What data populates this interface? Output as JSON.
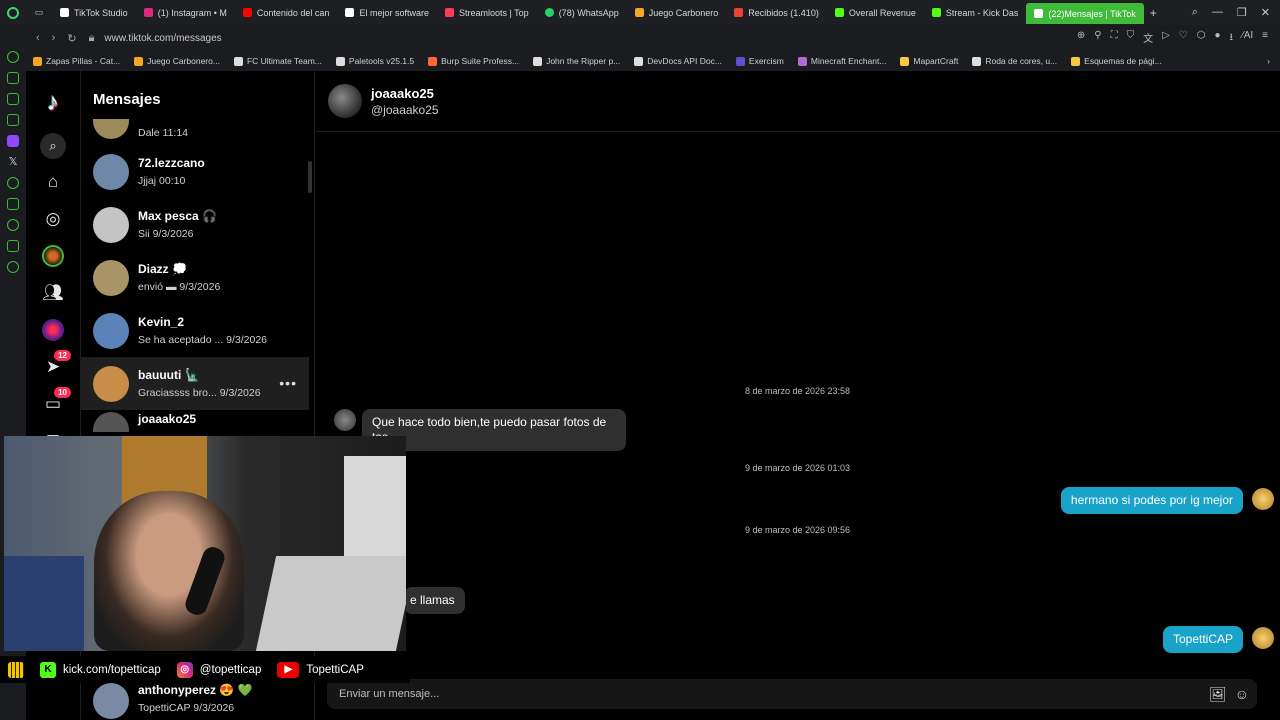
{
  "tabs": [
    {
      "label": "TikTok Studio",
      "color": "#ffffff"
    },
    {
      "label": "(1) Instagram • M",
      "color": "#dd2a7b"
    },
    {
      "label": "Contenido del can",
      "color": "#ff0000"
    },
    {
      "label": "El mejor software",
      "color": "#ffffff"
    },
    {
      "label": "Streamloots | Top",
      "color": "#ff3d5a"
    },
    {
      "label": "(78) WhatsApp",
      "color": "#25d366"
    },
    {
      "label": "Juego Carbonero",
      "color": "#f5a623"
    },
    {
      "label": "Recibidos (1.410)",
      "color": "#ea4335"
    },
    {
      "label": "Overall Revenue",
      "color": "#53fc18"
    },
    {
      "label": "Stream - Kick Das",
      "color": "#53fc18"
    },
    {
      "label": "(22)Mensajes | TikTok",
      "color": "#ffffff"
    }
  ],
  "address": {
    "url": "www.tiktok.com/messages"
  },
  "bookmarks": [
    {
      "label": "Zapas Pillas - Cat...",
      "color": "#f5a623"
    },
    {
      "label": "Juego Carbonero...",
      "color": "#f5a623"
    },
    {
      "label": "FC Ultimate Team...",
      "color": "#dddddd"
    },
    {
      "label": "Paletools v25.1.5",
      "color": "#dddddd"
    },
    {
      "label": "Burp Suite Profess...",
      "color": "#ff6633"
    },
    {
      "label": "John the Ripper p...",
      "color": "#dddddd"
    },
    {
      "label": "DevDocs API Doc...",
      "color": "#dddddd"
    },
    {
      "label": "Exercism",
      "color": "#604fcd"
    },
    {
      "label": "Minecraft Enchant...",
      "color": "#b06bd6"
    },
    {
      "label": "MapartCraft",
      "color": "#f5c842"
    },
    {
      "label": "Roda de cores, u...",
      "color": "#dddddd"
    },
    {
      "label": "Esquemas de pági...",
      "color": "#f5c842"
    }
  ],
  "nav": {
    "notif_badge": "12",
    "inbox_badge": "10"
  },
  "messages_panel": {
    "title": "Mensajes",
    "conversations": [
      {
        "name": "",
        "preview": "Dale 11:14",
        "avatar": "#9c8a5a"
      },
      {
        "name": "72.lezzcano",
        "preview": "Jjjaj 00:10",
        "avatar": "#6f88a8"
      },
      {
        "name": "Max pesca 🎧",
        "preview": "Sii 9/3/2026",
        "avatar": "#c4c4c4"
      },
      {
        "name": "Diazz 💭",
        "preview": "envió ▬ 9/3/2026",
        "avatar": "#a89466"
      },
      {
        "name": "Kevin_2",
        "preview": "Se ha aceptado ... 9/3/2026",
        "avatar": "#5b83b8"
      },
      {
        "name": "bauuuti 🗽",
        "preview": "Graciassss bro... 9/3/2026",
        "avatar": "#c98d4a"
      },
      {
        "name": "joaaako25",
        "preview": "",
        "avatar": "#555555"
      },
      {
        "name": "anthonyperez 😍 💚",
        "preview": "TopettiCAP 9/3/2026",
        "avatar": "#7a8aa5"
      }
    ]
  },
  "chat": {
    "display_name": "joaaako25",
    "handle": "@joaaako25",
    "stamps": [
      "8 de marzo de 2026 23:58",
      "9 de marzo de 2026 01:03",
      "9 de marzo de 2026 09:56"
    ],
    "incoming_1": "Que hace todo bien,te puedo pasar fotos de",
    "incoming_1b": "tas",
    "outgoing_1": "hermano si podes por ig mejor",
    "incoming_2": "e llamas",
    "outgoing_2": "TopettiCAP",
    "composer_placeholder": "Enviar un mensaje..."
  },
  "overlay": {
    "kick": "kick.com/topetticap",
    "instagram": "@topetticap",
    "youtube": "TopettiCAP"
  }
}
